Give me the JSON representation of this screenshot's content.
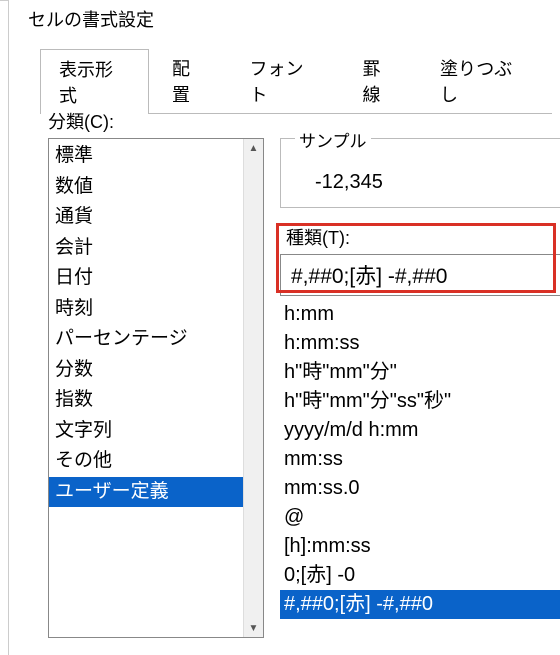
{
  "dialog": {
    "title": "セルの書式設定"
  },
  "tabs": [
    {
      "label": "表示形式",
      "active": true
    },
    {
      "label": "配置"
    },
    {
      "label": "フォント"
    },
    {
      "label": "罫線"
    },
    {
      "label": "塗りつぶし"
    }
  ],
  "category": {
    "label": "分類(C):",
    "items": [
      "標準",
      "数値",
      "通貨",
      "会計",
      "日付",
      "時刻",
      "パーセンテージ",
      "分数",
      "指数",
      "文字列",
      "その他",
      "ユーザー定義"
    ],
    "selected_index": 11
  },
  "sample": {
    "label": "サンプル",
    "value": "-12,345"
  },
  "type": {
    "label": "種類(T):",
    "value": "#,##0;[赤] -#,##0",
    "items": [
      "h:mm",
      "h:mm:ss",
      "h\"時\"mm\"分\"",
      "h\"時\"mm\"分\"ss\"秒\"",
      "yyyy/m/d h:mm",
      "mm:ss",
      "mm:ss.0",
      "@",
      "[h]:mm:ss",
      "0;[赤] -0",
      "#,##0;[赤] -#,##0"
    ],
    "selected_index": 10
  },
  "highlight": {
    "color": "#d93025"
  }
}
